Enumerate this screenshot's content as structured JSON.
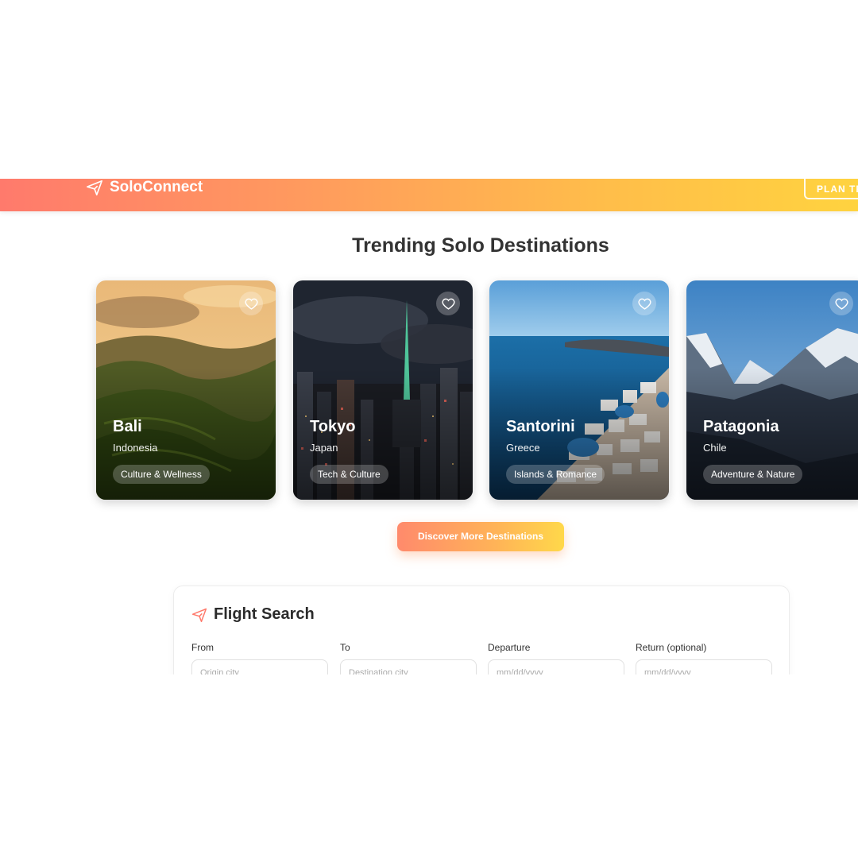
{
  "header": {
    "app_name": "SoloConnect",
    "cta_label": "PLAN TRIP",
    "colors": {
      "gradient_start": "#ff7a6c",
      "gradient_end": "#ffd33f"
    }
  },
  "trending": {
    "title": "Trending Solo Destinations",
    "destinations": [
      {
        "name": "Bali",
        "country": "Indonesia",
        "tag": "Culture & Wellness"
      },
      {
        "name": "Tokyo",
        "country": "Japan",
        "tag": "Tech & Culture"
      },
      {
        "name": "Santorini",
        "country": "Greece",
        "tag": "Islands & Romance"
      },
      {
        "name": "Patagonia",
        "country": "Chile",
        "tag": "Adventure & Nature"
      }
    ],
    "discover_label": "Discover More Destinations"
  },
  "flight_search": {
    "title": "Flight Search",
    "fields": [
      {
        "label": "From",
        "placeholder": "Origin city"
      },
      {
        "label": "To",
        "placeholder": "Destination city"
      },
      {
        "label": "Departure",
        "placeholder": "mm/dd/yyyy"
      },
      {
        "label": "Return (optional)",
        "placeholder": "mm/dd/yyyy"
      }
    ]
  },
  "icons": {
    "logo": "plane-icon",
    "favorite": "heart-icon",
    "flight": "plane-icon"
  }
}
